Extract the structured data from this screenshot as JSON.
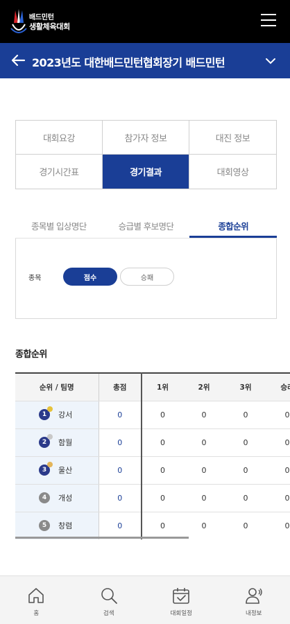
{
  "brand": {
    "line1": "배드민턴",
    "line2": "생활체육대회"
  },
  "header": {
    "title": "2023년도 대한배드민턴협회장기 배드민턴"
  },
  "main_tabs": [
    {
      "label": "대회요강",
      "active": false
    },
    {
      "label": "참가자 정보",
      "active": false
    },
    {
      "label": "대진 정보",
      "active": false
    },
    {
      "label": "경기시간표",
      "active": false
    },
    {
      "label": "경기결과",
      "active": true
    },
    {
      "label": "대회영상",
      "active": false
    }
  ],
  "sub_tabs": [
    {
      "label": "종목별 입상명단",
      "active": false
    },
    {
      "label": "승급별 후보명단",
      "active": false
    },
    {
      "label": "종합순위",
      "active": true
    }
  ],
  "filter": {
    "label": "종목",
    "option_selected": "점수",
    "option_other": "승패"
  },
  "section_title": "종합순위",
  "table": {
    "headers": [
      "순위 / 팀명",
      "총점",
      "1위",
      "2위",
      "3위",
      "승리"
    ],
    "rows": [
      {
        "rank": "1",
        "team": "강서",
        "total": "0",
        "c1": "0",
        "c2": "0",
        "c3": "0",
        "c4": "0"
      },
      {
        "rank": "2",
        "team": "함월",
        "total": "0",
        "c1": "0",
        "c2": "0",
        "c3": "0",
        "c4": "0"
      },
      {
        "rank": "3",
        "team": "울산",
        "total": "0",
        "c1": "0",
        "c2": "0",
        "c3": "0",
        "c4": "0"
      },
      {
        "rank": "4",
        "team": "개성",
        "total": "0",
        "c1": "0",
        "c2": "0",
        "c3": "0",
        "c4": "0"
      },
      {
        "rank": "5",
        "team": "창렴",
        "total": "0",
        "c1": "0",
        "c2": "0",
        "c3": "0",
        "c4": "0"
      }
    ]
  },
  "bottom_nav": [
    {
      "label": "홈",
      "icon": "home-icon"
    },
    {
      "label": "검색",
      "icon": "search-icon"
    },
    {
      "label": "대회일정",
      "icon": "calendar-icon"
    },
    {
      "label": "내정보",
      "icon": "user-icon"
    }
  ],
  "colors": {
    "primary": "#1a3e96",
    "header_bg": "#000000",
    "team_cell_bg": "#eef4fb"
  }
}
